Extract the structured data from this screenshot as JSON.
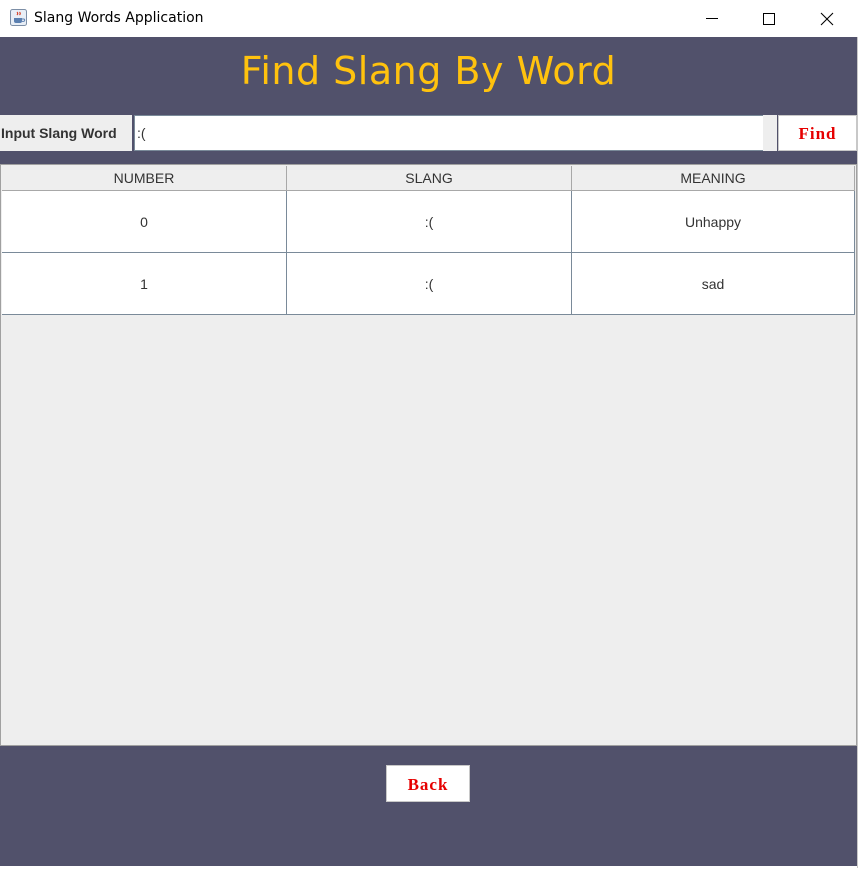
{
  "window": {
    "title": "Slang Words Application",
    "icons": {
      "app": "java-cup-icon",
      "minimize": "minimize-icon",
      "maximize": "maximize-icon",
      "close": "close-icon"
    }
  },
  "header": {
    "title": "Find Slang By Word",
    "input_label": "Input Slang Word",
    "input_value": ":(",
    "find_label": "Find"
  },
  "table": {
    "columns": [
      "NUMBER",
      "SLANG",
      "MEANING"
    ],
    "rows": [
      [
        "0",
        ":(",
        "Unhappy"
      ],
      [
        "1",
        ":(",
        "sad"
      ]
    ]
  },
  "footer": {
    "back_label": "Back"
  },
  "colors": {
    "panel": "#51516b",
    "title": "#ffc20e",
    "button_text": "#e60000",
    "table_bg": "#eeeeee"
  }
}
